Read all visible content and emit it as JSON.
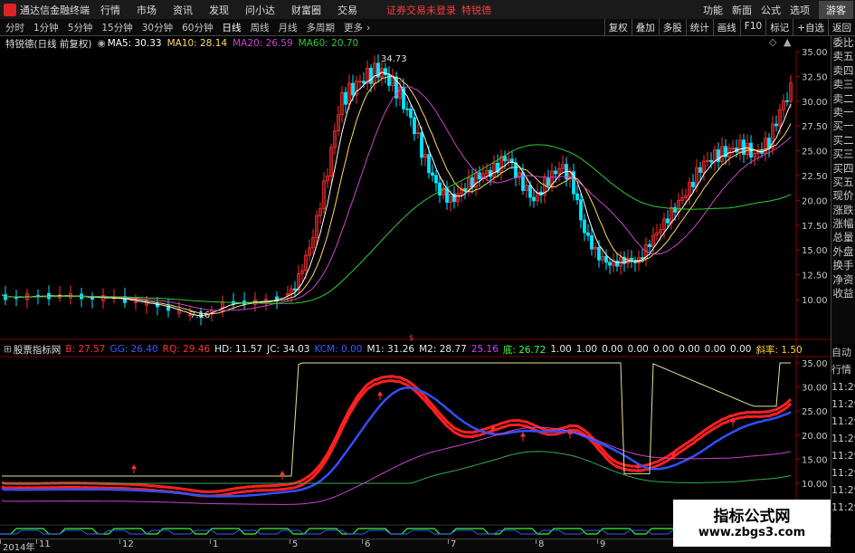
{
  "menubar": {
    "app_title": "通达信金融终端",
    "menus": [
      "行情",
      "市场",
      "资讯",
      "发现",
      "问小达",
      "财富圈",
      "交易"
    ],
    "notice": "证券交易未登录",
    "notice_stock": "特锐德",
    "right_items": [
      "功能",
      "新面",
      "公式",
      "选项"
    ],
    "guest": "游客"
  },
  "toolbar": {
    "periods": [
      "分时",
      "1分钟",
      "5分钟",
      "15分钟",
      "30分钟",
      "60分钟",
      "日线",
      "周线",
      "月线",
      "多周期",
      "更多"
    ],
    "active_period": "日线",
    "right_buttons": [
      "复权",
      "叠加",
      "多股",
      "统计",
      "画线",
      "F10",
      "标记",
      "+自选",
      "返回"
    ]
  },
  "main_info": {
    "title": "特锐德(日线 前复权)",
    "ma5": "MA5: 30.33",
    "ma10": "MA10: 28.14",
    "ma20": "MA20: 26.59",
    "ma60": "MA60: 20.70",
    "high_label": "34.73",
    "low_label": "7.16"
  },
  "indicator_info": {
    "name": "股票指标网",
    "items": [
      {
        "text": "B: 27.57",
        "color": "#ff3030"
      },
      {
        "text": "GG: 26.40",
        "color": "#3b5bff"
      },
      {
        "text": "RQ: 29.46",
        "color": "#ff3030"
      },
      {
        "text": "HD: 11.57",
        "color": "#e8e8e8"
      },
      {
        "text": "JC: 34.03",
        "color": "#e8e8e8"
      },
      {
        "text": "KCM: 0.00",
        "color": "#3b5bff"
      },
      {
        "text": "M1: 31.26",
        "color": "#e8e8e8"
      },
      {
        "text": "M2: 28.77",
        "color": "#e8e8e8"
      },
      {
        "text": "25.16",
        "color": "#cc44ff"
      },
      {
        "text": "底: 26.72",
        "color": "#40ff40"
      },
      {
        "text": "1.00",
        "color": "#e8e8e8"
      },
      {
        "text": "1.00",
        "color": "#e8e8e8"
      },
      {
        "text": "0.00",
        "color": "#e8e8e8"
      },
      {
        "text": "0.00",
        "color": "#e8e8e8"
      },
      {
        "text": "0.00",
        "color": "#e8e8e8"
      },
      {
        "text": "0.00",
        "color": "#e8e8e8"
      },
      {
        "text": "0.00",
        "color": "#e8e8e8"
      },
      {
        "text": "0.00",
        "color": "#e8e8e8"
      },
      {
        "text": "斜率: 1.50",
        "color": "#ffd040"
      }
    ]
  },
  "sidebar": [
    "委比",
    "卖五",
    "卖四",
    "卖三",
    "卖二",
    "卖一",
    "买一",
    "买二",
    "买三",
    "买四",
    "买五",
    "现价",
    "涨跌",
    "涨幅",
    "总量",
    "外盘",
    "换手",
    "净资",
    "收益"
  ],
  "sidebar2": [
    "自动",
    "行情",
    "11:29",
    "11:29",
    "11:29",
    "11:29",
    "11:29",
    "11:29",
    "11:29",
    "11:29"
  ],
  "price_axis": [
    "35.00",
    "32.50",
    "30.00",
    "27.50",
    "25.00",
    "22.50",
    "20.00",
    "17.50",
    "15.00",
    "12.50",
    "10.00"
  ],
  "ind_axis": [
    "35.00",
    "30.00",
    "25.00",
    "20.00",
    "15.00",
    "10.00"
  ],
  "date_axis": [
    {
      "label": "2014年",
      "pos": 0
    },
    {
      "label": "11",
      "pos": 40
    },
    {
      "label": "12",
      "pos": 132
    },
    {
      "label": "1",
      "pos": 232
    },
    {
      "label": "5",
      "pos": 320
    },
    {
      "label": "6",
      "pos": 400
    },
    {
      "label": "7",
      "pos": 495
    },
    {
      "label": "8",
      "pos": 592
    },
    {
      "label": "9",
      "pos": 660
    }
  ],
  "watermark": {
    "line1": "指标公式网",
    "line2": "www.zbgs3.com"
  },
  "colors": {
    "up": "#ff2e2e",
    "down": "#00e5ff",
    "ma5": "#ffffff",
    "ma10": "#ffd966",
    "ma20": "#cc44cc",
    "ma60": "#33cc33"
  }
}
